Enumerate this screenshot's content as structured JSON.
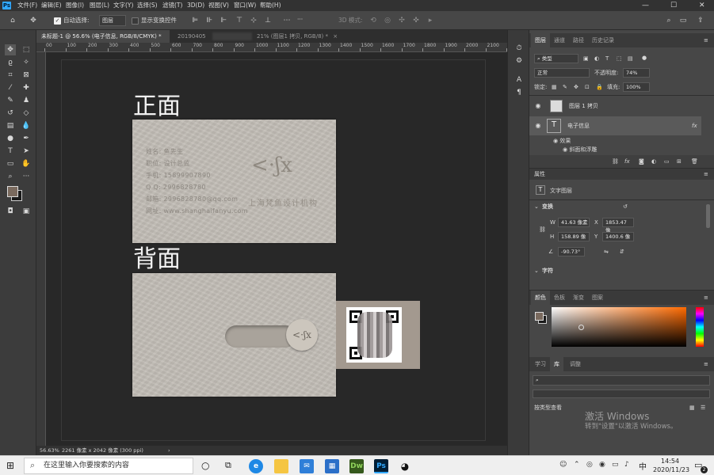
{
  "menubar": {
    "logo": "Ps",
    "items": [
      "文件(F)",
      "编辑(E)",
      "图像(I)",
      "图层(L)",
      "文字(Y)",
      "选择(S)",
      "滤镜(T)",
      "3D(D)",
      "视图(V)",
      "窗口(W)",
      "帮助(H)"
    ],
    "minimize": "—",
    "maximize": "☐",
    "close": "✕"
  },
  "options": {
    "auto_select_label": "自动选择:",
    "auto_select_value": "图层",
    "show_transform_label": "显示变换控件",
    "mode_3d_label": "3D 模式:",
    "more": "···"
  },
  "tabs": [
    {
      "label": "未标题-1 @ 56.6% (电子信息, RGB/8/CMYK) *",
      "close": "×"
    },
    {
      "label": "20190405",
      "close": ""
    },
    {
      "label": "21% (图层1 拷贝, RGB/8) *",
      "close": "×"
    }
  ],
  "ruler_ticks": [
    "00",
    "100",
    "200",
    "300",
    "400",
    "500",
    "600",
    "700",
    "800",
    "900",
    "1000",
    "1100",
    "1200",
    "1300",
    "1400",
    "1500",
    "1600",
    "1700",
    "1800",
    "1900",
    "2000",
    "2100",
    "2200"
  ],
  "canvas": {
    "front_title": "正面",
    "back_title": "背面",
    "card_lines": [
      "姓名: 鱼先生",
      "职位: 设计总监",
      "手机: 15899907890",
      "Q Q: 2996828780",
      "邮箱: 2996828780@qq.com",
      "网址: www.shanghaifanyu.com"
    ],
    "logo_glyph": "<·ʃx",
    "org_name": "上海梵鱼设计机构",
    "back_logo_glyph": "<·ʃx"
  },
  "status": {
    "zoom": "56.63%",
    "doc_info": "2261 像素 x 2042 像素 (300 ppi)",
    "arrow": "›"
  },
  "layers_panel": {
    "tabs": [
      "图层",
      "通道",
      "路径",
      "历史记录"
    ],
    "filter_label": "类型",
    "blend_mode": "正常",
    "opacity_label": "不透明度:",
    "opacity_value": "74%",
    "lock_label": "锁定:",
    "fill_label": "填充:",
    "fill_value": "100%",
    "layers": [
      {
        "name": "图层 1 拷贝",
        "thumb": ""
      },
      {
        "name": "电子信息",
        "thumb": "T",
        "fx": "fx"
      }
    ],
    "effects_label": "效果",
    "effect_item": "斜面和浮雕"
  },
  "properties_panel": {
    "title": "属性",
    "layer_type": "文字图层",
    "transform_label": "变换",
    "w_label": "W",
    "w_value": "41.63 像素",
    "x_label": "X",
    "x_value": "1853.47 像",
    "h_label": "H",
    "h_value": "158.89 像",
    "y_label": "Y",
    "y_value": "1400.6 像",
    "angle_value": "-90.73°",
    "char_label": "字符"
  },
  "color_panel": {
    "tabs": [
      "颜色",
      "色板",
      "渐变",
      "图案"
    ],
    "hue_color": "#ff6a00",
    "fg_color": "#7a6a5e",
    "bg_color": "#1a1a1a"
  },
  "library_panel": {
    "tabs": [
      "学习",
      "库",
      "调整"
    ],
    "view_label": "按类型查看"
  },
  "watermark": {
    "title": "激活 Windows",
    "subtitle": "转到\"设置\"以激活 Windows。"
  },
  "taskbar": {
    "search_placeholder": "在这里输入你要搜索的内容",
    "apps": [
      "Dw",
      "Ps"
    ],
    "ime": "中",
    "time": "14:54",
    "date": "2020/11/23",
    "notification_count": "2"
  }
}
